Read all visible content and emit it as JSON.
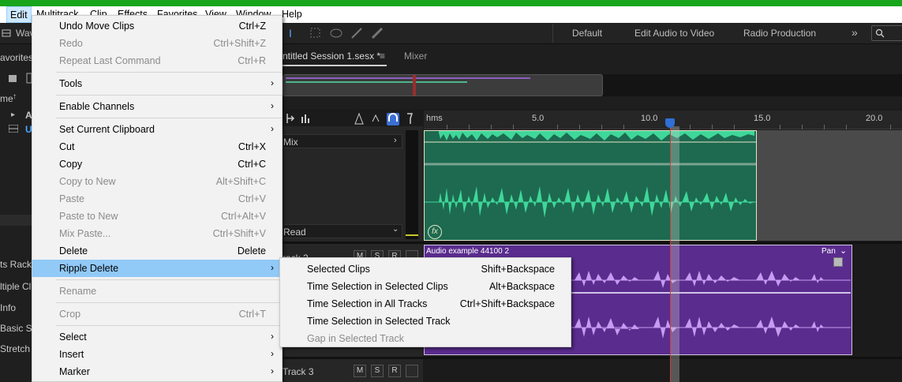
{
  "menubar": {
    "items": [
      "Edit",
      "Multitrack",
      "Clip",
      "Effects",
      "Favorites",
      "View",
      "Window",
      "Help"
    ]
  },
  "toolbar": {
    "workspaces": [
      "Default",
      "Edit Audio to Video",
      "Radio Production"
    ],
    "overflow": "»"
  },
  "left_panel": {
    "labels": [
      "Wav",
      "avorites",
      "me",
      "A",
      "U",
      "ts Rack",
      "ltiple Cl",
      "Info",
      "Basic Se",
      "Stretch"
    ]
  },
  "editor": {
    "session_tab": "ntitled Session 1.sesx *",
    "mixer_tab": "Mixer",
    "ruler": [
      "hms",
      "5.0",
      "10.0",
      "15.0",
      "20.0"
    ],
    "track1": {
      "output": "Mix",
      "mode": "Read",
      "fx": "fx"
    },
    "track2": {
      "name": "rack 2",
      "clip_title": "Audio example 44100 2",
      "pan": "Pan"
    },
    "track3": {
      "name": "Track 3"
    },
    "msr": [
      "M",
      "S",
      "R"
    ]
  },
  "edit_menu": {
    "items": [
      {
        "label": "Undo Move Clips",
        "shortcut": "Ctrl+Z"
      },
      {
        "label": "Redo",
        "shortcut": "Ctrl+Shift+Z"
      },
      {
        "label": "Repeat Last Command",
        "shortcut": "Ctrl+R"
      },
      {
        "label": "Tools",
        "shortcut": ""
      },
      {
        "label": "Enable Channels",
        "shortcut": ""
      },
      {
        "label": "Set Current Clipboard",
        "shortcut": ""
      },
      {
        "label": "Cut",
        "shortcut": "Ctrl+X"
      },
      {
        "label": "Copy",
        "shortcut": "Ctrl+C"
      },
      {
        "label": "Copy to New",
        "shortcut": "Alt+Shift+C"
      },
      {
        "label": "Paste",
        "shortcut": "Ctrl+V"
      },
      {
        "label": "Paste to New",
        "shortcut": "Ctrl+Alt+V"
      },
      {
        "label": "Mix Paste...",
        "shortcut": "Ctrl+Shift+V"
      },
      {
        "label": "Delete",
        "shortcut": "Delete"
      },
      {
        "label": "Ripple Delete",
        "shortcut": ""
      },
      {
        "label": "Rename",
        "shortcut": ""
      },
      {
        "label": "Crop",
        "shortcut": "Ctrl+T"
      },
      {
        "label": "Select",
        "shortcut": ""
      },
      {
        "label": "Insert",
        "shortcut": ""
      },
      {
        "label": "Marker",
        "shortcut": ""
      }
    ]
  },
  "ripple_menu": {
    "items": [
      {
        "label": "Selected Clips",
        "shortcut": "Shift+Backspace"
      },
      {
        "label": "Time Selection in Selected Clips",
        "shortcut": "Alt+Backspace"
      },
      {
        "label": "Time Selection in All Tracks",
        "shortcut": "Ctrl+Shift+Backspace"
      },
      {
        "label": "Time Selection in Selected Track",
        "shortcut": ""
      },
      {
        "label": "Gap in Selected Track",
        "shortcut": ""
      }
    ]
  },
  "colors": {
    "clip_green": "#1d6a50",
    "wave_green": "#3fd79a",
    "clip_purple": "#5a2c8e",
    "wave_purple": "#c69bf2",
    "highlight": "#91c9f7"
  }
}
